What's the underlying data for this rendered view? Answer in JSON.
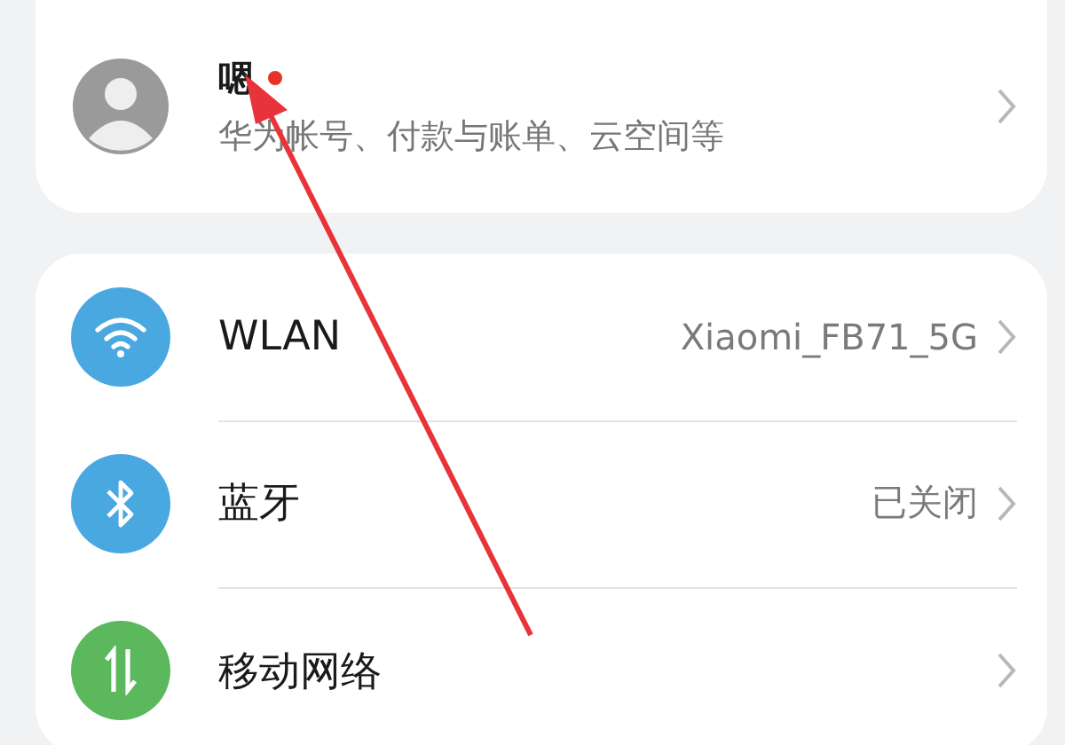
{
  "account": {
    "name": "嗯",
    "notification_dot": true,
    "subtitle": "华为帐号、付款与账单、云空间等"
  },
  "settings": [
    {
      "kind": "wifi",
      "label": "WLAN",
      "value": "Xiaomi_FB71_5G",
      "color": "#4aa8e0"
    },
    {
      "kind": "bluetooth",
      "label": "蓝牙",
      "value": "已关闭",
      "color": "#4aa8e0"
    },
    {
      "kind": "mobile-data",
      "label": "移动网络",
      "color": "#5cb85c"
    }
  ]
}
